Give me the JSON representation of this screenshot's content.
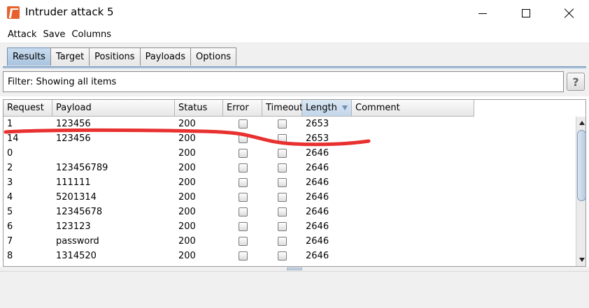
{
  "window": {
    "title": "Intruder attack 5"
  },
  "menu": [
    "Attack",
    "Save",
    "Columns"
  ],
  "tabs": [
    {
      "label": "Results",
      "active": true
    },
    {
      "label": "Target",
      "active": false
    },
    {
      "label": "Positions",
      "active": false
    },
    {
      "label": "Payloads",
      "active": false
    },
    {
      "label": "Options",
      "active": false
    }
  ],
  "filter": {
    "text": "Filter: Showing all items",
    "help_label": "?"
  },
  "table": {
    "columns": [
      "Request",
      "Payload",
      "Status",
      "Error",
      "Timeout",
      "Length",
      "Comment"
    ],
    "sorted_column": "Length",
    "rows": [
      {
        "request": "1",
        "payload": "123456",
        "status": "200",
        "error": false,
        "timeout": false,
        "length": "2653",
        "comment": ""
      },
      {
        "request": "14",
        "payload": "123456",
        "status": "200",
        "error": false,
        "timeout": false,
        "length": "2653",
        "comment": ""
      },
      {
        "request": "0",
        "payload": "",
        "status": "200",
        "error": false,
        "timeout": false,
        "length": "2646",
        "comment": ""
      },
      {
        "request": "2",
        "payload": "123456789",
        "status": "200",
        "error": false,
        "timeout": false,
        "length": "2646",
        "comment": ""
      },
      {
        "request": "3",
        "payload": "111111",
        "status": "200",
        "error": false,
        "timeout": false,
        "length": "2646",
        "comment": ""
      },
      {
        "request": "4",
        "payload": "5201314",
        "status": "200",
        "error": false,
        "timeout": false,
        "length": "2646",
        "comment": ""
      },
      {
        "request": "5",
        "payload": "12345678",
        "status": "200",
        "error": false,
        "timeout": false,
        "length": "2646",
        "comment": ""
      },
      {
        "request": "6",
        "payload": "123123",
        "status": "200",
        "error": false,
        "timeout": false,
        "length": "2646",
        "comment": ""
      },
      {
        "request": "7",
        "payload": "password",
        "status": "200",
        "error": false,
        "timeout": false,
        "length": "2646",
        "comment": ""
      },
      {
        "request": "8",
        "payload": "1314520",
        "status": "200",
        "error": false,
        "timeout": false,
        "length": "2646",
        "comment": ""
      }
    ]
  },
  "colors": {
    "active_tab": "#a9c4e0",
    "annotation": "#e8302f",
    "app_icon": "#e8612c"
  },
  "icons": {
    "app": "burp-logo-icon",
    "minimize": "minimize-icon",
    "maximize": "maximize-icon",
    "close": "close-icon",
    "sort": "sort-descending-icon"
  }
}
